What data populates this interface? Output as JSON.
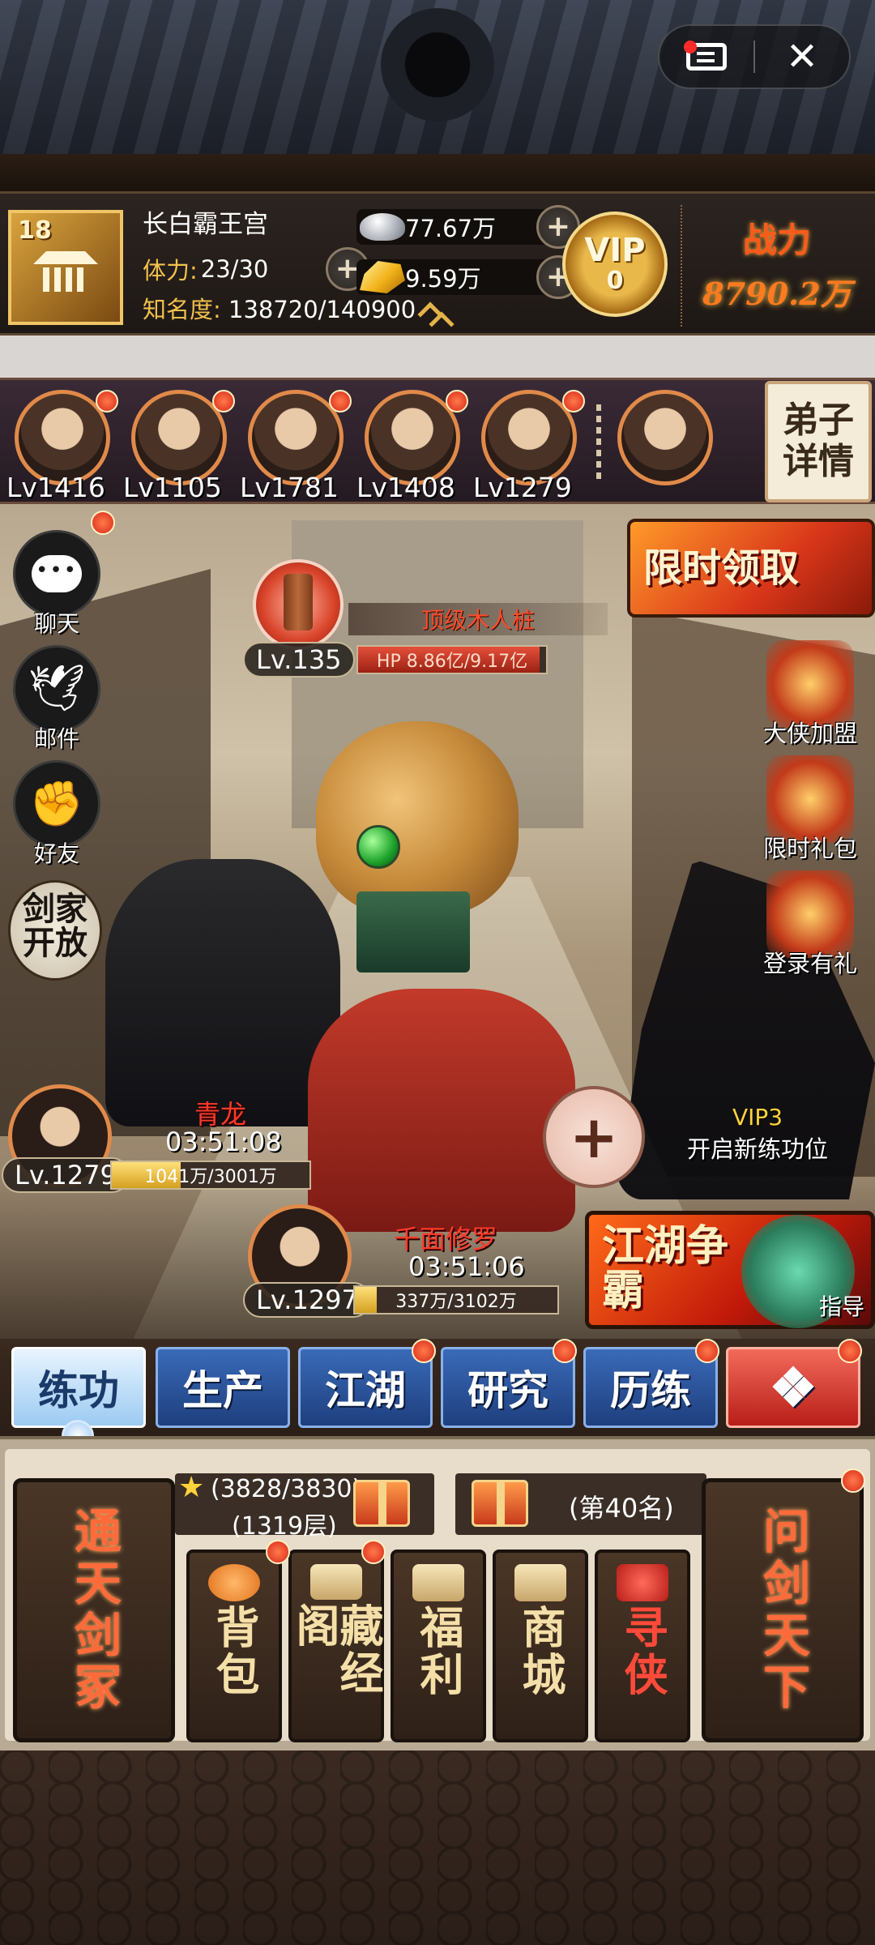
{
  "header": {
    "level": "18",
    "player_name": "长白霸王宫",
    "stamina_label": "体力:",
    "stamina_value": "23/30",
    "fame_label": "知名度:",
    "fame_value": "138720/140900",
    "silver": "77.67万",
    "gold": "9.59万",
    "vip_label": "VIP",
    "vip_level": "0",
    "power_label": "战力",
    "power_value": "8790.2万"
  },
  "disciples": {
    "items": [
      {
        "level": "Lv1416"
      },
      {
        "level": "Lv1105"
      },
      {
        "level": "Lv1781"
      },
      {
        "level": "Lv1408"
      },
      {
        "level": "Lv1279"
      }
    ],
    "detail_button": "弟子详情"
  },
  "side_menu": {
    "chat": "聊天",
    "mail": "邮件",
    "friends": "好友",
    "sword_home": "剑家开放"
  },
  "right_menu": {
    "limited_claim": "限时领取",
    "hero_join": "大侠加盟",
    "limited_gift": "限时礼包",
    "login_gift": "登录有礼",
    "jianghu": "江湖争霸",
    "guide": "指导"
  },
  "training": {
    "dummy_name": "顶级木人桩",
    "dummy_level": "Lv.135",
    "dummy_hp": "HP 8.86亿/9.17亿",
    "dummy_hp_fraction": 0.966,
    "slot1": {
      "name": "青龙",
      "timer": "03:51:08",
      "level": "Lv.1279",
      "progress": "1041万/3001万",
      "fraction": 0.347
    },
    "slot2": {
      "name": "千面修罗",
      "timer": "03:51:06",
      "level": "Lv.1297",
      "progress": "337万/3102万",
      "fraction": 0.109
    },
    "vip_unlock_label": "VIP3",
    "vip_unlock_text": "开启新练功位"
  },
  "tabs": {
    "items": [
      "练功",
      "生产",
      "江湖",
      "研究",
      "历练"
    ],
    "active": "练功"
  },
  "bottom": {
    "tower_progress": "(3828/3830)",
    "tower_floor": "(1319层)",
    "rank": "(第40名)",
    "left_big": "通天剑冢",
    "right_big": "问剑天下",
    "bag": "背包",
    "library": "藏经阁",
    "welfare": "福利",
    "shop": "商城",
    "seek_hero": "寻侠"
  },
  "colors": {
    "accent_orange": "#ff6a3a",
    "tab_blue": "#3a6ab8",
    "hp_red": "#e5503a",
    "progress_gold": "#ffe07a"
  }
}
